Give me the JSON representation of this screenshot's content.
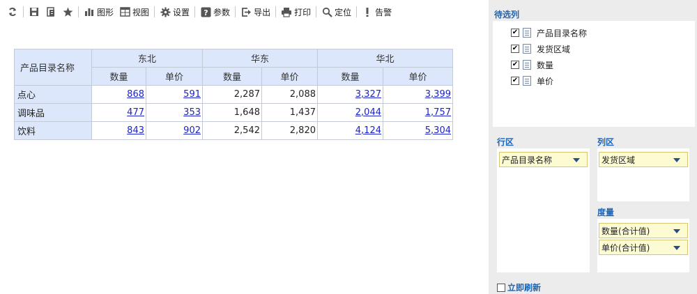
{
  "toolbar": {
    "refresh_icon": "refresh-icon",
    "save_icon": "save-icon",
    "save_as_icon": "save-as-icon",
    "favorite_icon": "star-icon",
    "chart_label": "图形",
    "view_label": "视图",
    "settings_label": "设置",
    "params_label": "参数",
    "export_label": "导出",
    "print_label": "打印",
    "locate_label": "定位",
    "alert_label": "告警"
  },
  "table": {
    "corner": "产品目录名称",
    "regions": [
      "东北",
      "华东",
      "华北"
    ],
    "measures": [
      "数量",
      "单价"
    ],
    "rows": [
      {
        "name": "点心",
        "values": [
          "868",
          "591",
          "2,287",
          "2,088",
          "3,327",
          "3,399"
        ]
      },
      {
        "name": "调味品",
        "values": [
          "477",
          "353",
          "1,648",
          "1,437",
          "2,044",
          "1,757"
        ]
      },
      {
        "name": "饮料",
        "values": [
          "843",
          "902",
          "2,542",
          "2,820",
          "4,124",
          "5,304"
        ]
      }
    ],
    "link_columns": [
      0,
      1,
      4,
      5
    ]
  },
  "panel": {
    "candidates_title": "待选列",
    "candidates": [
      "产品目录名称",
      "发货区域",
      "数量",
      "单价"
    ],
    "row_area_title": "行区",
    "row_area_items": [
      "产品目录名称"
    ],
    "col_area_title": "列区",
    "col_area_items": [
      "发货区域"
    ],
    "measure_title": "度量",
    "measure_items": [
      "数量(合计值)",
      "单价(合计值)"
    ],
    "refresh_label": "立即刷新"
  },
  "colors": {
    "header_bg": "#dde7fb",
    "link": "#1a22c9",
    "panel_title": "#1e64b4",
    "chip_bg": "#fdfbd2"
  }
}
